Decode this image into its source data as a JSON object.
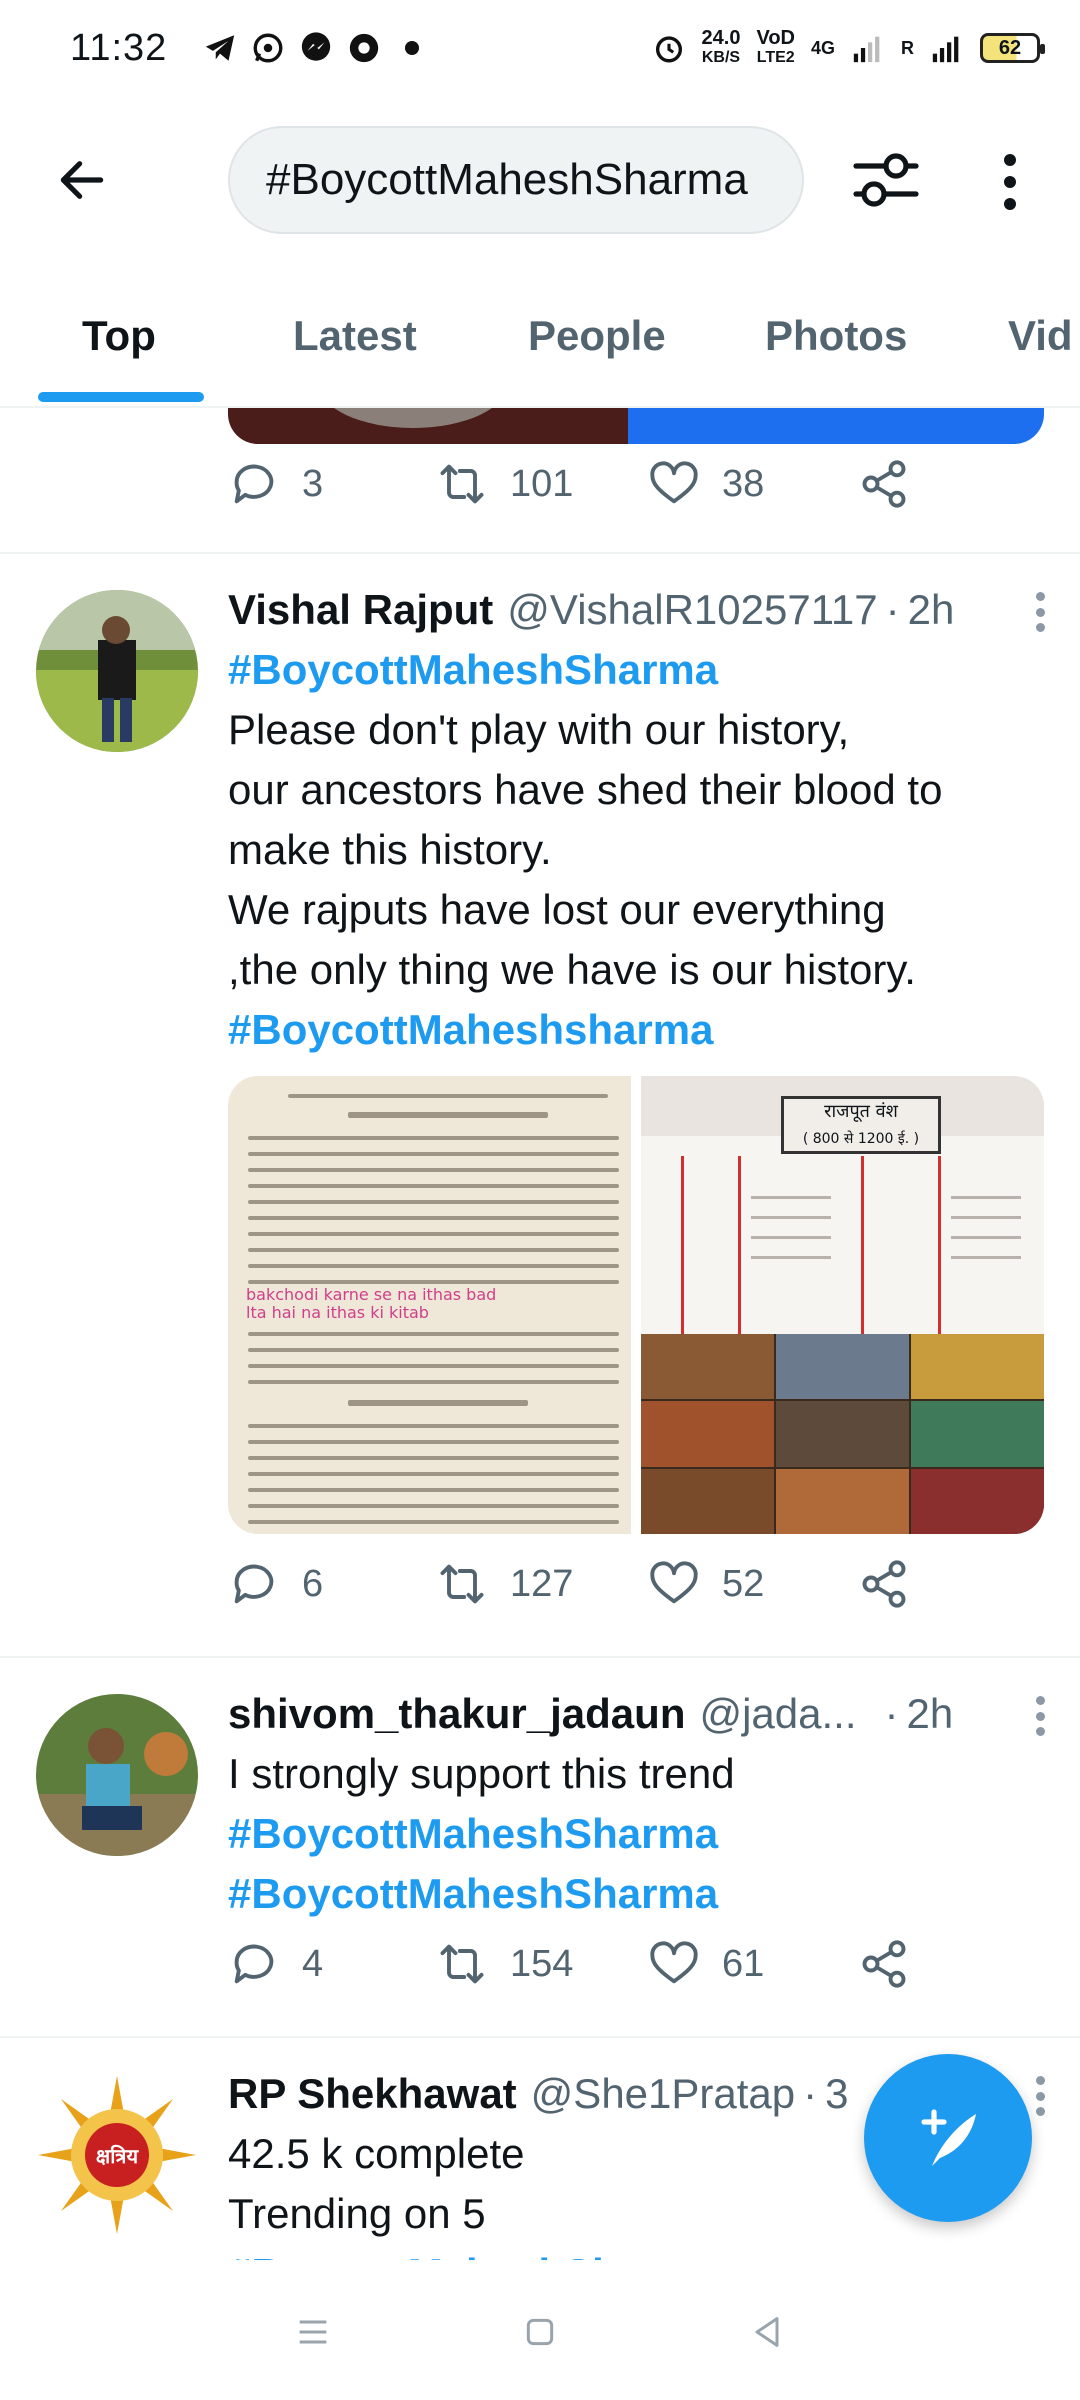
{
  "status_bar": {
    "time": "11:32",
    "net_speed_value": "24.0",
    "net_speed_unit": "KB/S",
    "volte_top": "VoD",
    "volte_bottom": "LTE2",
    "signal_label": "4G",
    "roaming_label": "R",
    "battery_level": "62"
  },
  "search": {
    "query": "#BoycottMaheshSharma"
  },
  "tabs": [
    {
      "label": "Top",
      "active": true
    },
    {
      "label": "Latest"
    },
    {
      "label": "People"
    },
    {
      "label": "Photos"
    },
    {
      "label": "Vid"
    }
  ],
  "previous_tweet": {
    "replies": "3",
    "retweets": "101",
    "likes": "38"
  },
  "tweets": [
    {
      "display_name": "Vishal Rajput",
      "handle": "@VishalR10257117",
      "time": "2h",
      "hashtag_top": "#BoycottMaheshSharma",
      "text": "Please don't play with our history,\nour ancestors have shed their blood to\nmake this history.\nWe rajputs have lost our everything\n,the only thing we have is our history.",
      "hashtag_bottom": "#BoycottMaheshsharma",
      "media_left_caption": "bakchodi karne se na ithas bad\nlta hai na ithas ki kitab",
      "media_right_title": "राजपूत वंश",
      "media_right_subtitle": "( 800 से 1200 ई. )",
      "replies": "6",
      "retweets": "127",
      "likes": "52"
    },
    {
      "display_name": "shivom_thakur_jadaun",
      "handle": "@jada...",
      "time": "2h",
      "text": "I strongly support this trend",
      "hashtag_1": "#BoycottMaheshSharma",
      "hashtag_2": "#BoycottMaheshSharma",
      "replies": "4",
      "retweets": "154",
      "likes": "61"
    },
    {
      "display_name": "RP Shekhawat",
      "handle": "@She1Pratap",
      "time": "3",
      "line_1": "42.5 k complete",
      "line_2": "Trending on 5",
      "hashtag_partial": "#BoycottMaheshSharma",
      "avatar_text": "क्षत्रिय"
    }
  ],
  "colors": {
    "accent": "#1d9bf0",
    "text_primary": "#0f1419",
    "text_secondary": "#536471"
  }
}
